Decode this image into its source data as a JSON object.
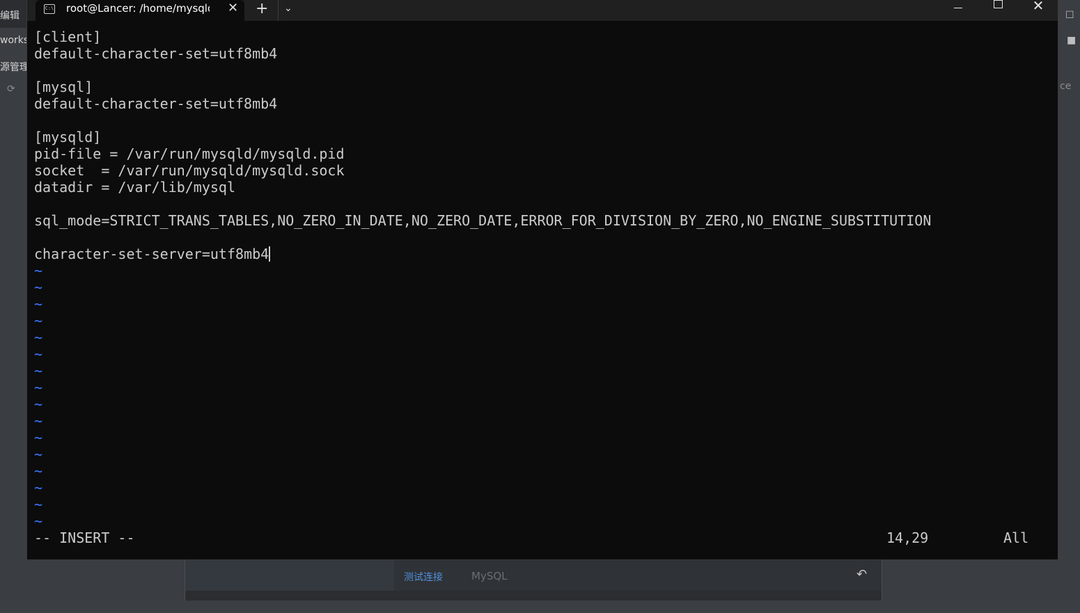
{
  "background_app": {
    "left_items": [
      "编辑",
      "works",
      "源管理器"
    ],
    "dialog": {
      "test_connection_label": "测试连接",
      "db_type_label": "MySQL"
    },
    "right_partial_text": "ce"
  },
  "terminal": {
    "tab_title": "root@Lancer: /home/mysqld",
    "tab_icon": "terminal-prompt-icon",
    "new_tab_label": "+",
    "editor": {
      "lines": [
        "[client]",
        "default-character-set=utf8mb4",
        "",
        "[mysql]",
        "default-character-set=utf8mb4",
        "",
        "[mysqld]",
        "pid-file = /var/run/mysqld/mysqld.pid",
        "socket  = /var/run/mysqld/mysqld.sock",
        "datadir = /var/lib/mysql",
        "",
        "sql_mode=STRICT_TRANS_TABLES,NO_ZERO_IN_DATE,NO_ZERO_DATE,ERROR_FOR_DIVISION_BY_ZERO,NO_ENGINE_SUBSTITUTION",
        "",
        "character-set-server=utf8mb4"
      ],
      "empty_line_marker": "~",
      "empty_lines": [
        "~",
        "~",
        "~",
        "~",
        "~",
        "~",
        "~",
        "~",
        "~",
        "~",
        "~",
        "~",
        "~",
        "~",
        "~",
        "~"
      ],
      "status_mode": "-- INSERT --",
      "status_position": "14,29",
      "status_scroll": "All"
    },
    "colors": {
      "background": "#0c0c0c",
      "text": "#cccccc",
      "tilde": "#3b78ff",
      "titlebar": "#202020"
    }
  }
}
